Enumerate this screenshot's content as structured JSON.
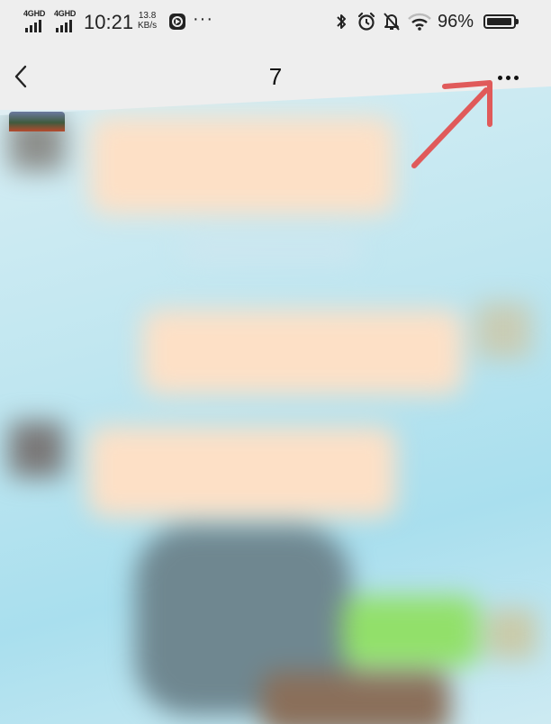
{
  "status_bar": {
    "sim1_label": "4GHD",
    "sim2_label": "4GHD",
    "time": "10:21",
    "net_speed_value": "13.8",
    "net_speed_unit": "KB/s",
    "more_icon": "···",
    "battery_percent": "96%",
    "battery_level": 0.96
  },
  "nav": {
    "title": "7"
  },
  "annotation": {
    "color": "#e05a5a"
  },
  "colors": {
    "bubble_peach": "#fde0c6",
    "bubble_green": "#92e06a",
    "background": "#bfe6f0"
  }
}
